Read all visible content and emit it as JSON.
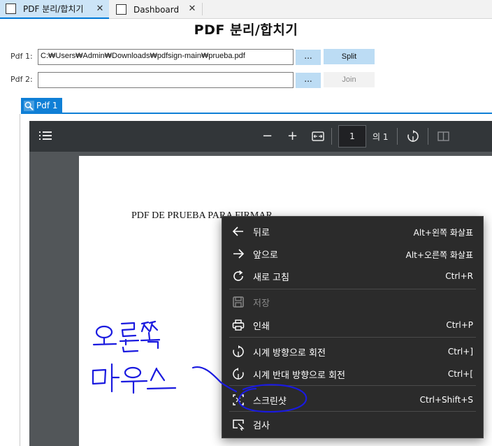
{
  "tabs": [
    {
      "label": "PDF 분리/합치기",
      "close": "✕"
    },
    {
      "label": "Dashboard",
      "close": "✕"
    }
  ],
  "title": "PDF 분리/합치기",
  "form": {
    "pdf1_label": "Pdf 1:",
    "pdf1_value": "C:₩Users₩Admin₩Downloads₩pdfsign-main₩prueba.pdf",
    "pdf2_label": "Pdf 2:",
    "pdf2_value": "",
    "browse_label": "...",
    "split_label": "Split",
    "join_label": "Join"
  },
  "doc_tab": {
    "label": "Pdf 1"
  },
  "viewer": {
    "page_current": "1",
    "page_total": "의 1",
    "zoom_out": "−",
    "zoom_in": "+"
  },
  "document": {
    "text": "PDF DE PRUEBA PARA FIRMAR"
  },
  "context_menu": {
    "items": [
      {
        "label": "뒤로",
        "shortcut": "Alt+왼쪽 화살표",
        "icon": "arrow-left-icon"
      },
      {
        "label": "앞으로",
        "shortcut": "Alt+오른쪽 화살표",
        "icon": "arrow-right-icon"
      },
      {
        "label": "새로 고침",
        "shortcut": "Ctrl+R",
        "icon": "refresh-icon"
      },
      {
        "label": "저장",
        "shortcut": "",
        "icon": "save-icon",
        "disabled": true
      },
      {
        "label": "인쇄",
        "shortcut": "Ctrl+P",
        "icon": "print-icon"
      },
      {
        "label": "시계 방향으로 회전",
        "shortcut": "Ctrl+]",
        "icon": "rotate-clockwise-icon"
      },
      {
        "label": "시계 반대 방향으로 회전",
        "shortcut": "Ctrl+[",
        "icon": "rotate-counterclockwise-icon"
      },
      {
        "label": "스크린샷",
        "shortcut": "Ctrl+Shift+S",
        "icon": "screenshot-icon"
      },
      {
        "label": "검사",
        "shortcut": "",
        "icon": "inspect-icon"
      }
    ]
  },
  "annotation": {
    "color": "#1a1adf"
  },
  "colors": {
    "accent": "#0f7fd6",
    "button": "#bcdcf4",
    "menu_bg": "#2b2b2b",
    "viewer_toolbar": "#323639"
  }
}
